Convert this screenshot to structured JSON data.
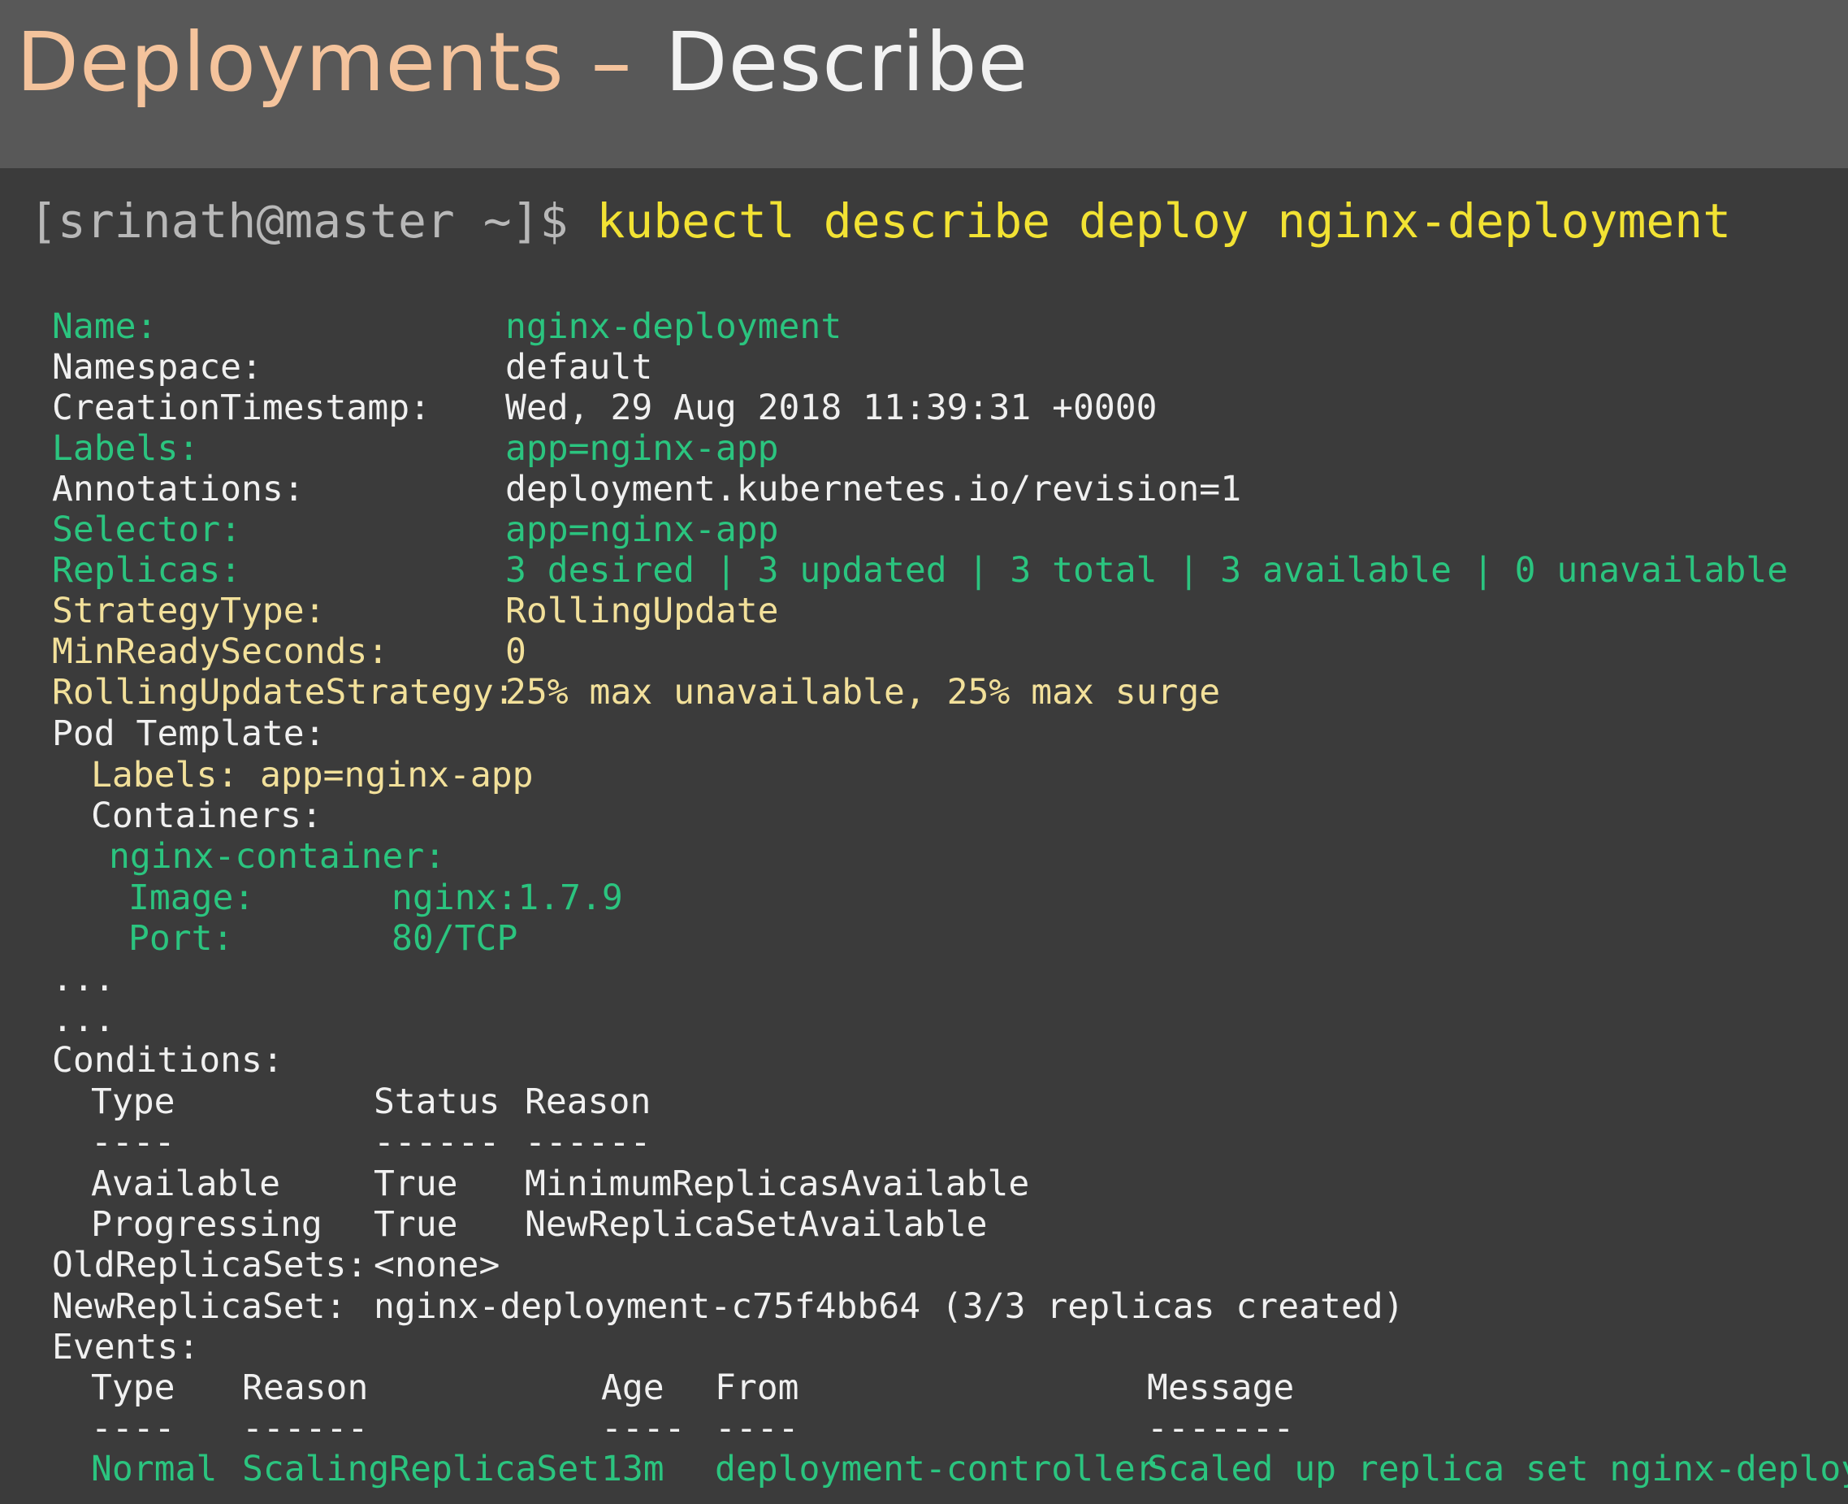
{
  "slide": {
    "title_part1": "Deployments –",
    "title_part2": "Describe"
  },
  "terminal": {
    "prompt": "[srinath@master ~]$",
    "command": "kubectl describe deploy nginx-deployment",
    "fields": [
      {
        "key": "Name:",
        "value": "nginx-deployment",
        "color": "#2bc47f"
      },
      {
        "key": "Namespace:",
        "value": "default",
        "color": "#f0f0f0"
      },
      {
        "key": "CreationTimestamp:",
        "value": "Wed, 29 Aug 2018 11:39:31 +0000",
        "color": "#f0f0f0"
      },
      {
        "key": "Labels:",
        "value": "app=nginx-app",
        "color": "#2bc47f"
      },
      {
        "key": "Annotations:",
        "value": "deployment.kubernetes.io/revision=1",
        "color": "#f0f0f0"
      },
      {
        "key": "Selector:",
        "value": "app=nginx-app",
        "color": "#2bc47f"
      },
      {
        "key": "Replicas:",
        "value": "3 desired | 3 updated | 3 total | 3 available | 0 unavailable",
        "color": "#2bc47f"
      },
      {
        "key": "StrategyType:",
        "value": "RollingUpdate",
        "color": "#f2e09a"
      },
      {
        "key": "MinReadySeconds:",
        "value": "0",
        "color": "#f2e09a"
      },
      {
        "key": "RollingUpdateStrategy:",
        "value": "25% max unavailable, 25% max surge",
        "color": "#f2e09a"
      }
    ],
    "pod_template": {
      "heading": "Pod Template:",
      "labels_key": "Labels:",
      "labels_value": "app=nginx-app",
      "containers_heading": "Containers:",
      "container_name": "nginx-container:",
      "image_key": "Image:",
      "image_value": "nginx:1.7.9",
      "port_key": "Port:",
      "port_value": "80/TCP"
    },
    "ellipsis": "...",
    "conditions": {
      "heading": "Conditions:",
      "headers": [
        "Type",
        "Status",
        "Reason"
      ],
      "dashes": [
        "----",
        "------",
        "------"
      ],
      "rows": [
        [
          "Available",
          "True",
          "MinimumReplicasAvailable"
        ],
        [
          "Progressing",
          "True",
          "NewReplicaSetAvailable"
        ]
      ]
    },
    "old_replica_sets": {
      "key": "OldReplicaSets:",
      "value": "<none>"
    },
    "new_replica_set": {
      "key": "NewReplicaSet:",
      "value": "nginx-deployment-c75f4bb64 (3/3 replicas created)"
    },
    "events": {
      "heading": "Events:",
      "headers": [
        "Type",
        "Reason",
        "Age",
        "From",
        "Message"
      ],
      "dashes": [
        "----",
        "------",
        "----",
        "----",
        "-------"
      ],
      "rows": [
        [
          "Normal",
          "ScalingReplicaSet",
          "13m",
          "deployment-controller",
          "Scaled up replica set nginx-deployment"
        ]
      ]
    }
  }
}
